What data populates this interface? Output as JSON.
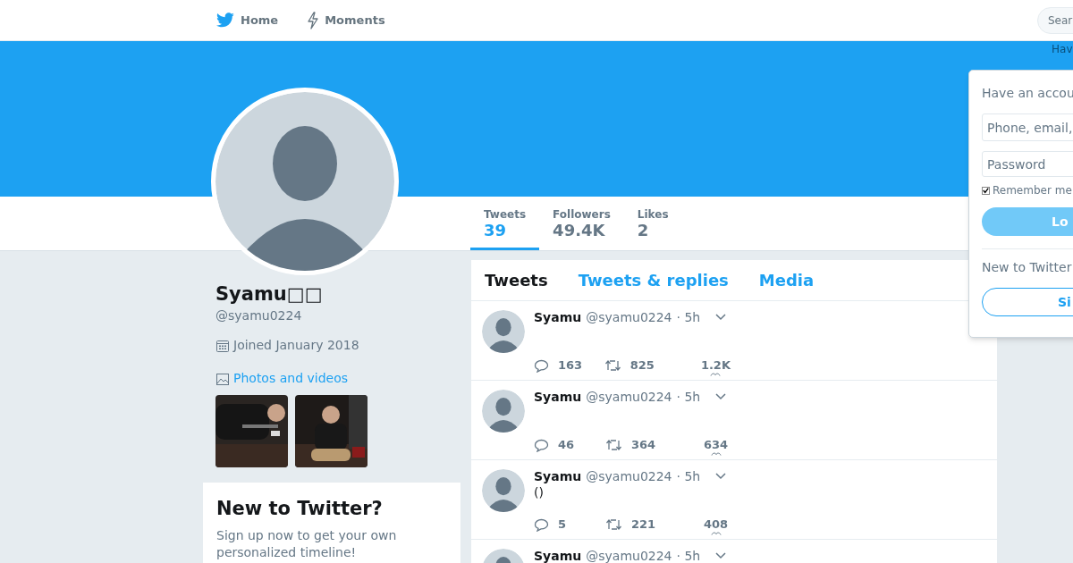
{
  "nav": {
    "items": [
      {
        "label": "Home",
        "kind": "bird"
      },
      {
        "label": "Moments",
        "kind": "bolt"
      }
    ],
    "search": {
      "placeholder": "Sear"
    },
    "hint": "Hav"
  },
  "stats": [
    {
      "label": "Tweets",
      "value": "39",
      "selected": true
    },
    {
      "label": "Followers",
      "value": "49.4K",
      "selected": false
    },
    {
      "label": "Likes",
      "value": "2",
      "selected": false
    }
  ],
  "profile": {
    "name": "Syamu□□",
    "handle": "@syamu0224",
    "joined": "Joined January 2018",
    "media_link": "Photos and videos"
  },
  "signup_card": {
    "title": "New to Twitter?",
    "text": "Sign up now to get your own personalized timeline!"
  },
  "timeline_tabs": [
    {
      "label": "Tweets",
      "selected": true
    },
    {
      "label": "Tweets & replies",
      "selected": false
    },
    {
      "label": "Media",
      "selected": false
    }
  ],
  "tweets": [
    {
      "name": "Syamu",
      "handle": "@syamu0224",
      "time": "· 5h",
      "replies": "163",
      "retweets": "825",
      "likes": "1.2K"
    },
    {
      "name": "Syamu",
      "handle": "@syamu0224",
      "time": "· 5h",
      "replies": "46",
      "retweets": "364",
      "likes": "634"
    },
    {
      "name": "Syamu",
      "handle": "@syamu0224",
      "time": "· 5h",
      "text": "()",
      "replies": "5",
      "retweets": "221",
      "likes": "408"
    },
    {
      "name": "Syamu",
      "handle": "@syamu0224",
      "time": "· 5h"
    }
  ],
  "login": {
    "title": "Have an accou",
    "username_placeholder": "Phone, email,",
    "password_placeholder": "Password",
    "remember": {
      "label": "Remember me",
      "checked": true
    },
    "login_button": "Lo",
    "new_text": "New to Twitter",
    "signup_button": "Si"
  }
}
